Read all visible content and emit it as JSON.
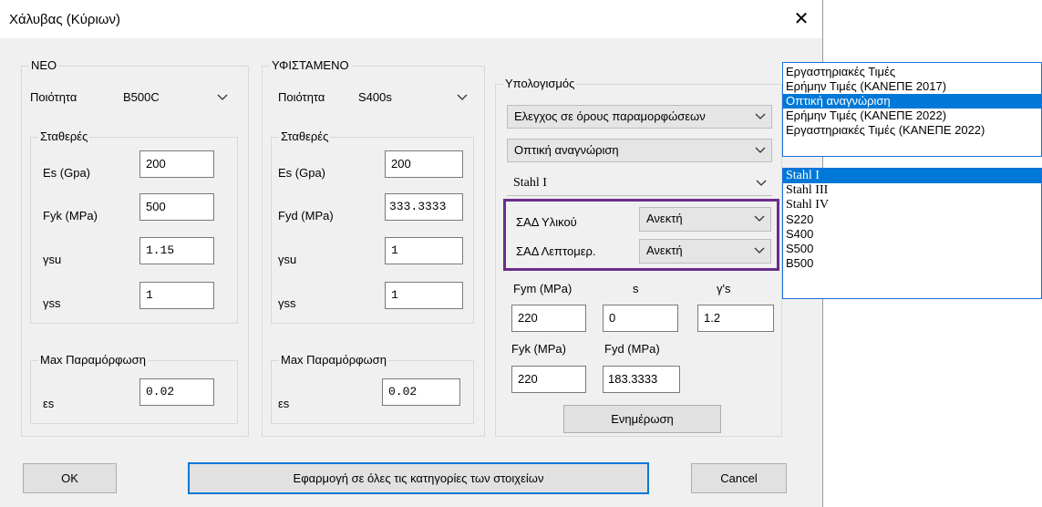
{
  "window": {
    "title": "Χάλυβας (Κύριων)",
    "close_glyph": "✕"
  },
  "neo": {
    "legend": "ΝΕΟ",
    "quality_label": "Ποιότητα",
    "quality_value": "B500C",
    "constants_legend": "Σταθερές",
    "rows": [
      {
        "label": "Es (Gpa)",
        "value": "200"
      },
      {
        "label": "Fyk (MPa)",
        "value": "500"
      },
      {
        "label": "γsu",
        "value": "1.15"
      },
      {
        "label": "γss",
        "value": "1"
      }
    ],
    "maxdef_legend": "Max Παραμόρφωση",
    "es_label": "εs",
    "es_value": "0.02"
  },
  "existing": {
    "legend": "ΥΦΙΣΤΑΜΕΝΟ",
    "quality_label": "Ποιότητα",
    "quality_value": "S400s",
    "constants_legend": "Σταθερές",
    "rows": [
      {
        "label": "Es (Gpa)",
        "value": "200"
      },
      {
        "label": "Fyd (MPa)",
        "value": "333.3333"
      },
      {
        "label": "γsu",
        "value": "1"
      },
      {
        "label": "γss",
        "value": "1"
      }
    ],
    "maxdef_legend": "Max Παραμόρφωση",
    "es_label": "εs",
    "es_value": "0.02"
  },
  "calc": {
    "legend": "Υπολογισμός",
    "combo1": "Ελεγχος σε όρους παραμορφώσεων",
    "combo2": "Οπτική αναγνώριση",
    "combo3": "Stahl I",
    "sad_material_label": "ΣΑΔ Υλικού",
    "sad_material_value": "Ανεκτή",
    "sad_detail_label": "ΣΑΔ Λεπτομερ.",
    "sad_detail_value": "Ανεκτή",
    "fym_label": "Fym (MPa)",
    "fym_value": "220",
    "s_label": "s",
    "s_value": "0",
    "gs_label": "γ's",
    "gs_value": "1.2",
    "fyk_label": "Fyk (MPa)",
    "fyk_value": "220",
    "fyd_label": "Fyd (MPa)",
    "fyd_value": "183.3333",
    "update_button": "Ενημέρωση"
  },
  "footer": {
    "ok": "OK",
    "apply_all": "Εφαρμογή σε όλες τις κατηγορίες των στοιχείων",
    "cancel": "Cancel"
  },
  "list1": {
    "items": [
      "Εργαστηριακές Τιμές",
      "Ερήμην Τιμές (ΚΑΝΕΠΕ 2017)",
      "Οπτική αναγνώριση",
      "Ερήμην Τιμές (ΚΑΝΕΠΕ 2022)",
      "Εργαστηριακές Τιμές (ΚΑΝΕΠΕ 2022)"
    ],
    "selected": "Οπτική αναγνώριση"
  },
  "list2": {
    "items": [
      "Stahl I",
      "Stahl III",
      "Stahl IV",
      "S220",
      "S400",
      "S500",
      "B500"
    ],
    "selected": "Stahl I"
  },
  "colors": {
    "accent": "#0078d7",
    "highlight_box": "#6b2d8a",
    "dialog_bg": "#f0f0f0"
  }
}
